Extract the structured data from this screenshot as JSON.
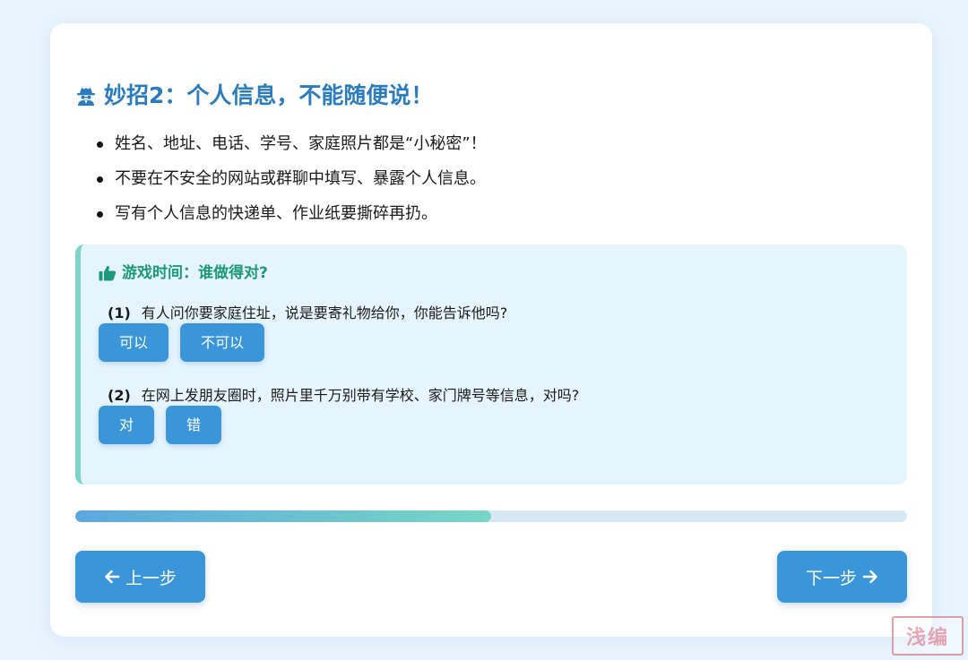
{
  "section": {
    "title": "妙招2：个人信息，不能随便说！",
    "title_icon": "spy-icon"
  },
  "bullets": [
    "姓名、地址、电话、学号、家庭照片都是“小秘密”！",
    "不要在不安全的网站或群聊中填写、暴露个人信息。",
    "写有个人信息的快递单、作业纸要撕碎再扔。"
  ],
  "game": {
    "title": "游戏时间：谁做得对?",
    "title_icon": "thumbs-up-icon",
    "questions": [
      {
        "num": "(1)",
        "text": "有人问你要家庭住址，说是要寄礼物给你，你能告诉他吗?",
        "options": [
          "可以",
          "不可以"
        ]
      },
      {
        "num": "(2)",
        "text": "在网上发朋友圈时，照片里千万别带有学校、家门牌号等信息，对吗?",
        "options": [
          "对",
          "错"
        ]
      }
    ]
  },
  "progress": {
    "fraction": 0.5
  },
  "nav": {
    "prev_label": "上一步",
    "next_label": "下一步",
    "prev_icon": "arrow-left-icon",
    "next_icon": "arrow-right-icon"
  },
  "watermark": {
    "text": "浅编"
  },
  "colors": {
    "page_bg": "#e8f4fd",
    "title": "#2b7bbd",
    "button": "#3a96d8",
    "game_title": "#1b9877",
    "game_border": "#7dd5c8",
    "game_bg": "#e6f5fd"
  }
}
